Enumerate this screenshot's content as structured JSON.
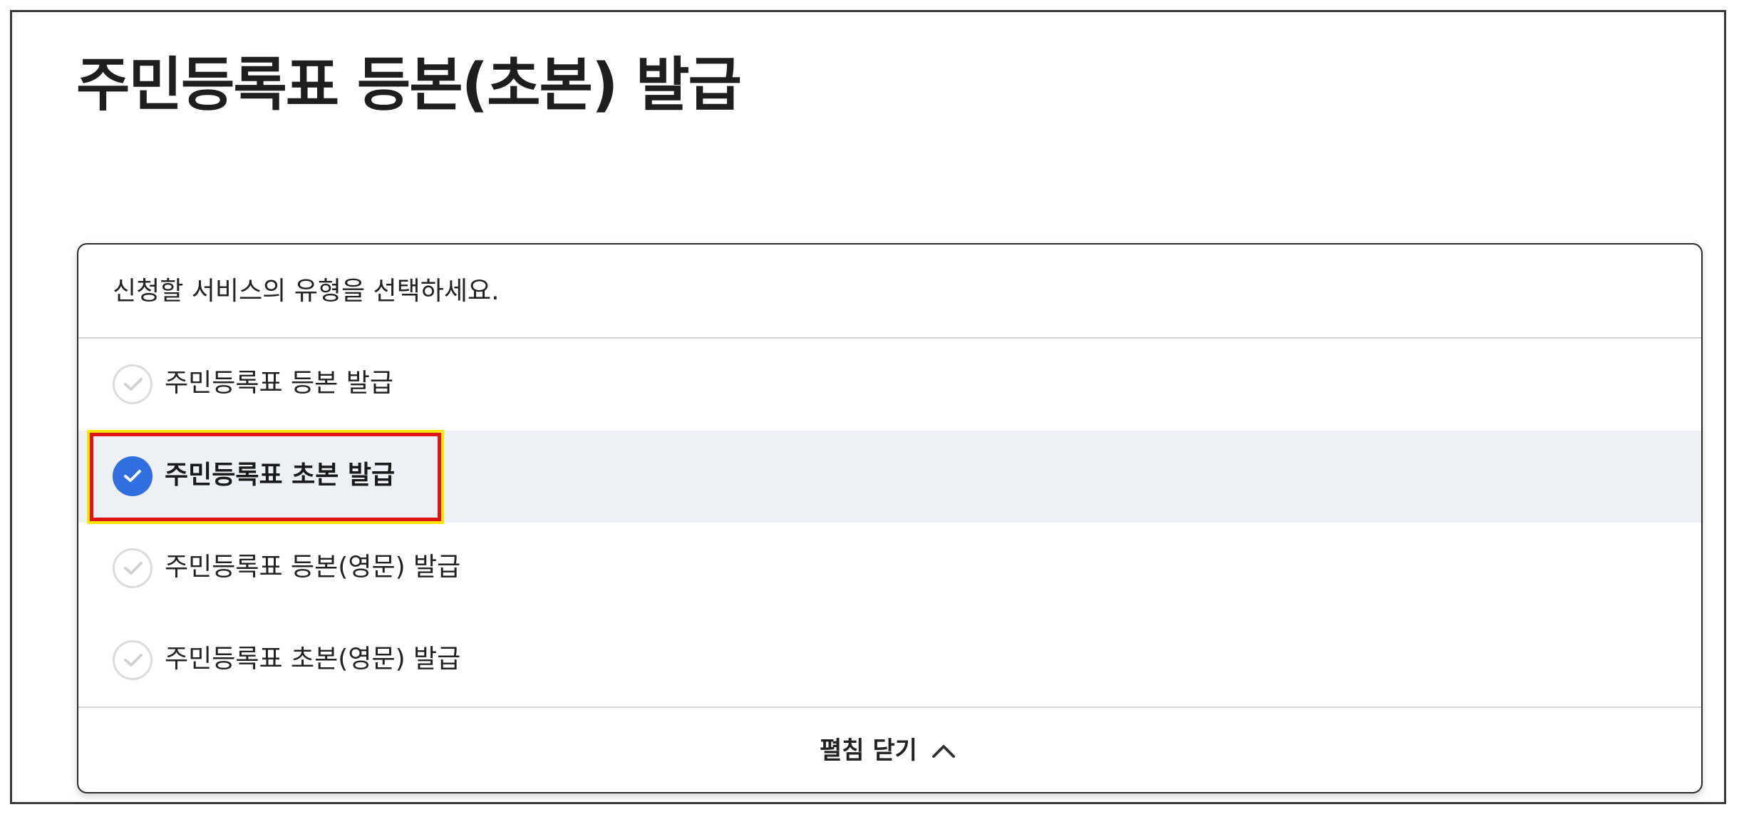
{
  "page": {
    "title": "주민등록표 등본(초본) 발급"
  },
  "service_panel": {
    "prompt": "신청할 서비스의 유형을 선택하세요.",
    "options": [
      {
        "label": "주민등록표 등본 발급",
        "selected": false
      },
      {
        "label": "주민등록표 초본 발급",
        "selected": true
      },
      {
        "label": "주민등록표 등본(영문) 발급",
        "selected": false
      },
      {
        "label": "주민등록표 초본(영문) 발급",
        "selected": false
      }
    ],
    "collapse_label": "펼침 닫기",
    "icons": {
      "check": "check-icon",
      "collapse": "chevron-up-icon"
    }
  },
  "colors": {
    "accent": "#2f6fe0",
    "selected_row_bg": "#edf0f4",
    "highlight_border": "#e2141a",
    "highlight_outline": "#ffe600"
  }
}
